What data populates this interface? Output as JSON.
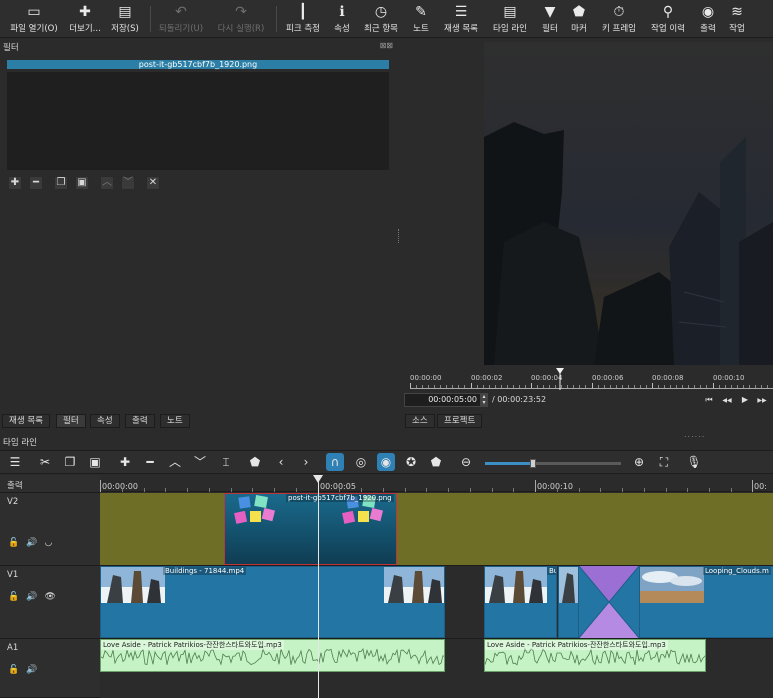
{
  "toolbar": {
    "items": [
      {
        "label": "파일 열기(O)",
        "icon": "folder-open-icon",
        "glyph": "▭"
      },
      {
        "label": "더보기...",
        "icon": "open-other-icon",
        "glyph": "✚"
      },
      {
        "label": "저장(S)",
        "icon": "save-icon",
        "glyph": "💾"
      },
      {
        "label": "되돌리기(U)",
        "icon": "undo-icon",
        "glyph": "↶"
      },
      {
        "label": "다시 실행(R)",
        "icon": "redo-icon",
        "glyph": "↷"
      },
      {
        "label": "피크 측정",
        "icon": "peak-meter-icon",
        "glyph": "┃"
      },
      {
        "label": "속성",
        "icon": "properties-icon",
        "glyph": "ℹ"
      },
      {
        "label": "최근 항목",
        "icon": "recent-icon",
        "glyph": "◷"
      },
      {
        "label": "노트",
        "icon": "notes-icon",
        "glyph": "✎"
      },
      {
        "label": "재생 목록",
        "icon": "playlist-icon",
        "glyph": "☰"
      },
      {
        "label": "타임 라인",
        "icon": "timeline-icon",
        "glyph": "▤"
      },
      {
        "label": "필터",
        "icon": "filter-icon",
        "glyph": "▼"
      },
      {
        "label": "마커",
        "icon": "marker-icon",
        "glyph": "⬟"
      },
      {
        "label": "키 프레임",
        "icon": "keyframe-icon",
        "glyph": "⏱"
      },
      {
        "label": "작업 이력",
        "icon": "history-icon",
        "glyph": "⚲"
      },
      {
        "label": "출력",
        "icon": "export-icon",
        "glyph": "◉"
      },
      {
        "label": "작업",
        "icon": "jobs-icon",
        "glyph": "≋"
      }
    ]
  },
  "filter_panel": {
    "title": "필터",
    "controls": "⊠⊠",
    "selected_clip": "post-it-gb517cbf7b_1920.png",
    "buttons": [
      {
        "name": "add-filter-button",
        "glyph": "✚"
      },
      {
        "name": "remove-filter-button",
        "glyph": "━"
      },
      {
        "name": "copy-filter-button",
        "glyph": "❐"
      },
      {
        "name": "paste-filter-button",
        "glyph": "▣"
      },
      {
        "name": "move-up-button",
        "glyph": "︿"
      },
      {
        "name": "move-down-button",
        "glyph": "﹀"
      },
      {
        "name": "deselect-filter-button",
        "glyph": "✕"
      }
    ]
  },
  "player": {
    "ruler_labels": [
      "00:00:00",
      "00:00:02",
      "00:00:04",
      "00:00:06",
      "00:00:08",
      "00:00:10"
    ],
    "current_time": "00:00:05:00",
    "total_time": "/ 00:00:23:52",
    "transport": [
      {
        "name": "skip-to-start-button",
        "glyph": "⏮"
      },
      {
        "name": "rewind-button",
        "glyph": "◀◀"
      },
      {
        "name": "play-button",
        "glyph": "▶"
      },
      {
        "name": "fast-forward-button",
        "glyph": "▶▶"
      }
    ]
  },
  "left_tabs": [
    "재생 목록",
    "필터",
    "속성",
    "출력",
    "노트"
  ],
  "player_tabs": [
    "소스",
    "프로젝트"
  ],
  "timeline": {
    "title": "타임 라인",
    "dots": "......",
    "tools": [
      {
        "name": "timeline-menu-icon",
        "glyph": "☰"
      },
      {
        "name": "cut-icon",
        "glyph": "✂"
      },
      {
        "name": "copy-icon",
        "glyph": "❐"
      },
      {
        "name": "paste-icon",
        "glyph": "▣"
      },
      {
        "name": "append-icon",
        "glyph": "✚"
      },
      {
        "name": "remove-icon",
        "glyph": "━"
      },
      {
        "name": "lift-icon",
        "glyph": "︿"
      },
      {
        "name": "overwrite-icon",
        "glyph": "﹀"
      },
      {
        "name": "split-icon",
        "glyph": "⌶"
      },
      {
        "name": "marker-icon",
        "glyph": "⬟"
      },
      {
        "name": "previous-marker-icon",
        "glyph": "‹"
      },
      {
        "name": "next-marker-icon",
        "glyph": "›"
      },
      {
        "name": "snap-icon",
        "glyph": "∩"
      },
      {
        "name": "scrub-icon",
        "glyph": "◎"
      },
      {
        "name": "ripple-icon",
        "glyph": "◉"
      },
      {
        "name": "ripple-all-icon",
        "glyph": "✪"
      },
      {
        "name": "ripple-markers-icon",
        "glyph": "⬟"
      },
      {
        "name": "zoom-out-icon",
        "glyph": "⊖"
      },
      {
        "name": "zoom-in-icon",
        "glyph": "⊕"
      },
      {
        "name": "zoom-fit-icon",
        "glyph": "⛶"
      },
      {
        "name": "record-audio-icon",
        "glyph": "🎙"
      }
    ],
    "zoom_level": 0.35,
    "ruler_labels": [
      "00:00:00",
      "00:00:05",
      "00:00:10",
      "00:"
    ],
    "tracks": [
      {
        "name": "출력",
        "kind": "output"
      },
      {
        "name": "V2",
        "kind": "video",
        "icons": [
          "🔓",
          "🔊",
          "◡"
        ]
      },
      {
        "name": "V1",
        "kind": "video",
        "icons": [
          "🔓",
          "🔊",
          "👁"
        ]
      },
      {
        "name": "A1",
        "kind": "audio",
        "icons": [
          "🔓",
          "🔊"
        ]
      }
    ],
    "clips": {
      "v2": [
        {
          "label": "post-it-gb517cbf7b_1920.png"
        }
      ],
      "v1": [
        {
          "label": "Buildings - 71844.mp4"
        },
        {
          "label": "Bu"
        },
        {
          "label": ""
        },
        {
          "label": "Looping_Clouds.m"
        }
      ],
      "a1": [
        {
          "label": "Love Aside - Patrick Patrikios-잔잔한스타트와도입.mp3"
        },
        {
          "label": "Love Aside - Patrick Patrikios-잔잔한스타트와도입.mp3"
        }
      ]
    },
    "colors": {
      "v2_lane": "#6e6e27",
      "v1_clip": "#2375a3",
      "audio_clip": "#c6f3c5",
      "transition": "#9b6fd4"
    }
  }
}
